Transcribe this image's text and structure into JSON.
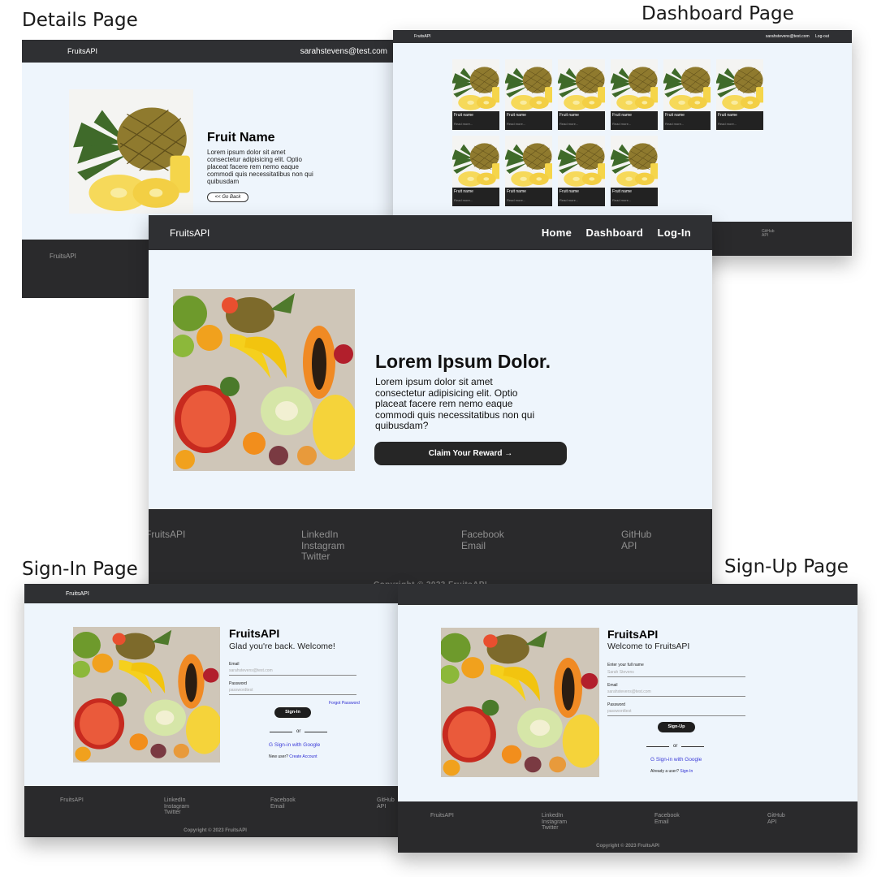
{
  "labels": {
    "details": "Details Page",
    "dashboard": "Dashboard Page",
    "signin": "Sign-In Page",
    "signup": "Sign-Up Page"
  },
  "brand": "FruitsAPI",
  "details": {
    "user_email": "sarahstevens@test.com",
    "title": "Fruit Name",
    "description": "Lorem ipsum dolor sit amet consectetur adipisicing elit. Optio placeat facere rem nemo eaque commodi quis necessitatibus non qui quibusdam",
    "back_label": "<< Go Back",
    "footer_brand": "FruitsAPI"
  },
  "dashboard": {
    "user_email": "sarahstevens@test.com",
    "logout": "Log-out",
    "cards": [
      {
        "name": "Fruit name",
        "more": "Read more..."
      },
      {
        "name": "Fruit name",
        "more": "Read more..."
      },
      {
        "name": "Fruit name",
        "more": "Read more..."
      },
      {
        "name": "Fruit name",
        "more": "Read more..."
      },
      {
        "name": "Fruit name",
        "more": "Read more..."
      },
      {
        "name": "Fruit name",
        "more": "Read more..."
      },
      {
        "name": "Fruit name",
        "more": "Read more..."
      },
      {
        "name": "Fruit name",
        "more": "Read more..."
      },
      {
        "name": "Fruit name",
        "more": "Read more..."
      },
      {
        "name": "Fruit name",
        "more": "Read more..."
      }
    ],
    "footer": [
      "GitHub",
      "API"
    ]
  },
  "home": {
    "nav": [
      "Home",
      "Dashboard",
      "Log-In"
    ],
    "headline": "Lorem Ipsum Dolor.",
    "description": "Lorem ipsum dolor sit amet consectetur adipisicing elit. Optio placeat facere rem nemo eaque commodi quis necessitatibus non qui quibusdam?",
    "cta": "Claim Your Reward →",
    "footer": {
      "brand": "FruitsAPI",
      "col1": [
        "LinkedIn",
        "Instagram",
        "Twitter"
      ],
      "col2": [
        "Facebook",
        "Email"
      ],
      "col3": [
        "GitHub",
        "API"
      ],
      "copyright": "Copyright © 2023 FruitsAPI"
    }
  },
  "signin": {
    "title": "FruitsAPI",
    "subtitle": "Glad you're back. Welcome!",
    "email_label": "Email",
    "email_value": "sarahstevens@test.com",
    "password_label": "Password",
    "password_value": "passwordtest",
    "forgot": "Forgot Password",
    "button": "Sign-In",
    "or": "or",
    "google": "G Sign-in with Google",
    "new_user": "New user?",
    "create": "Create Account",
    "footer": {
      "brand": "FruitsAPI",
      "col1": [
        "LinkedIn",
        "Instagram",
        "Twitter"
      ],
      "col2": [
        "Facebook",
        "Email"
      ],
      "col3": [
        "GitHub",
        "API"
      ],
      "copyright": "Copyright © 2023 FruitsAPI"
    }
  },
  "signup": {
    "title": "FruitsAPI",
    "subtitle": "Welcome to FruitsAPI",
    "name_label": "Enter your full name",
    "name_value": "Sarah Stevens",
    "email_label": "Email",
    "email_value": "sarahstevens@test.com",
    "password_label": "Password",
    "password_value": "passwordtest",
    "button": "Sign-Up",
    "or": "or",
    "google": "G Sign-in with Google",
    "already": "Already a user?",
    "signin_link": "Sign-In",
    "footer": {
      "brand": "FruitsAPI",
      "col1": [
        "LinkedIn",
        "Instagram",
        "Twitter"
      ],
      "col2": [
        "Facebook",
        "Email"
      ],
      "col3": [
        "GitHub",
        "API"
      ],
      "copyright": "Copyright © 2023 FruitsAPI"
    }
  }
}
